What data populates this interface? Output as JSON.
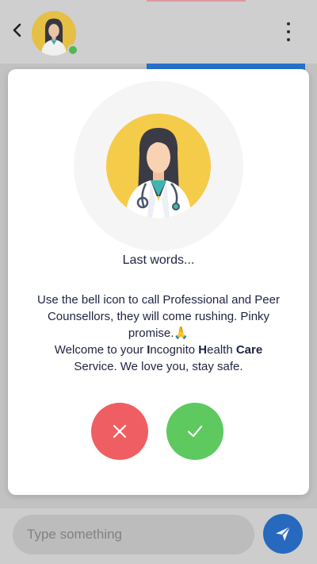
{
  "header": {
    "back_icon": "chevron-left-icon",
    "menu_icon": "more-vertical-icon",
    "avatar": "doctor-avatar",
    "status_color": "#56c35a"
  },
  "composer": {
    "placeholder": "Type something",
    "send_icon": "send-icon",
    "send_color": "#2970c9"
  },
  "modal": {
    "title": "Last words...",
    "line1": "Use the bell icon to call Professional and Peer Counsellors, they will come rushing. Pinky promise.",
    "pray_emoji": "🙏",
    "welcome_prefix": "Welcome to your ",
    "w1_initial": "I",
    "w1_rest": "ncognito ",
    "w2_initial": "H",
    "w2_rest": "ealth ",
    "w3": "Care",
    "line2_end": "Service. We love you, stay safe.",
    "cancel_icon": "close-icon",
    "confirm_icon": "check-icon",
    "cancel_color": "#ef5e62",
    "confirm_color": "#5dc95f"
  }
}
